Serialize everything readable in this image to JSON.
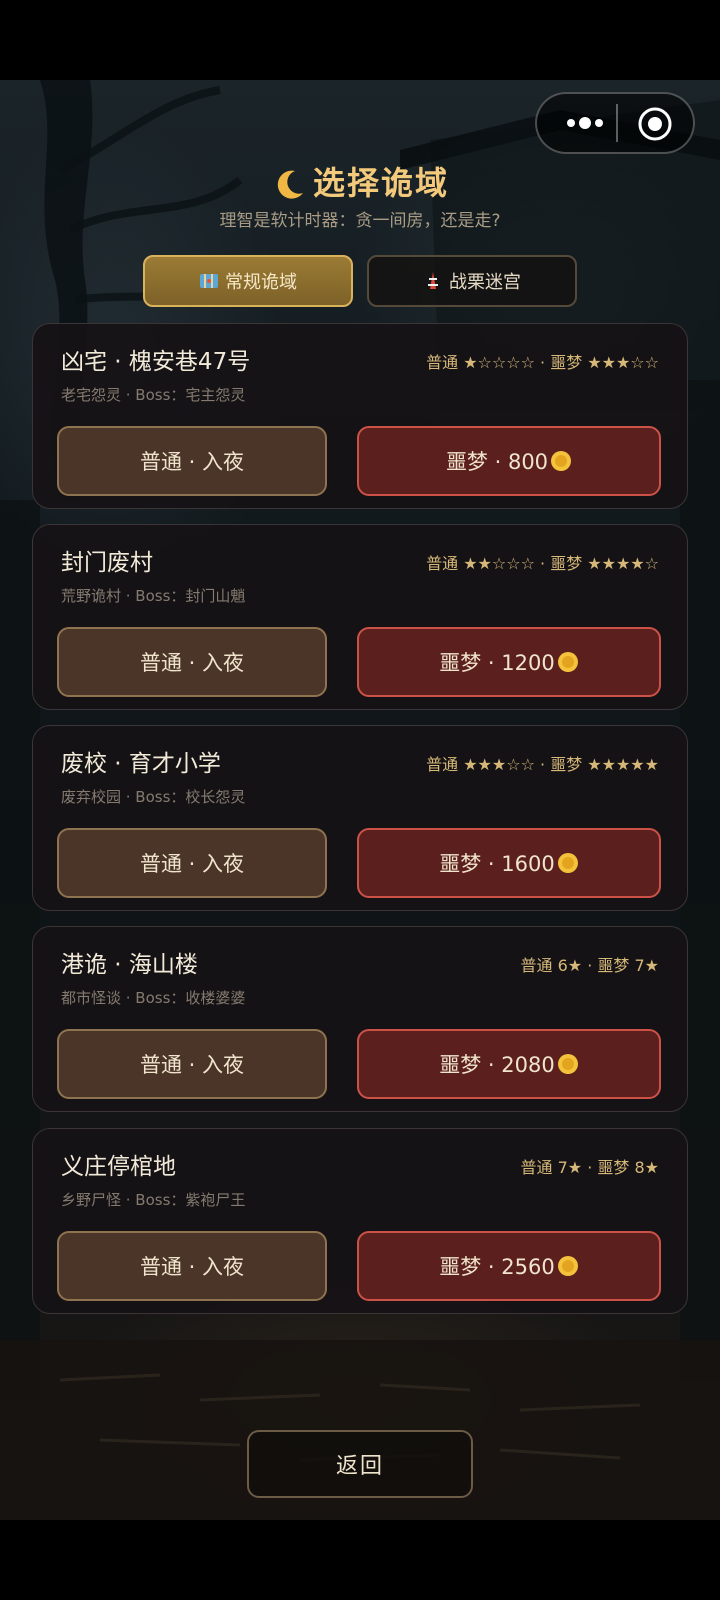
{
  "header": {
    "title": "选择诡域",
    "subtitle": "理智是软计时器：贪一间房，还是走?"
  },
  "tabs": [
    {
      "label": "常规诡域",
      "icon": "map-icon",
      "active": true
    },
    {
      "label": "战栗迷宫",
      "icon": "tower-icon",
      "active": false
    }
  ],
  "domains": [
    {
      "name": "凶宅 · 槐安巷47号",
      "meta": "老宅怨灵 · Boss：宅主怨灵",
      "difficulty": "普通 ★☆☆☆☆ · 噩梦 ★★★☆☆",
      "normal_label": "普通 · 入夜",
      "nightmare_label": "噩梦 · 800"
    },
    {
      "name": "封门废村",
      "meta": "荒野诡村 · Boss：封门山魈",
      "difficulty": "普通 ★★☆☆☆ · 噩梦 ★★★★☆",
      "normal_label": "普通 · 入夜",
      "nightmare_label": "噩梦 · 1200"
    },
    {
      "name": "废校 · 育才小学",
      "meta": "废弃校园 · Boss：校长怨灵",
      "difficulty": "普通 ★★★☆☆ · 噩梦 ★★★★★",
      "normal_label": "普通 · 入夜",
      "nightmare_label": "噩梦 · 1600"
    },
    {
      "name": "港诡 · 海山楼",
      "meta": "都市怪谈 · Boss：收楼婆婆",
      "difficulty": "普通 6★ · 噩梦 7★",
      "normal_label": "普通 · 入夜",
      "nightmare_label": "噩梦 · 2080"
    },
    {
      "name": "义庄停棺地",
      "meta": "乡野尸怪 · Boss：紫袍尸王",
      "difficulty": "普通 7★ · 噩梦 8★",
      "normal_label": "普通 · 入夜",
      "nightmare_label": "噩梦 · 2560"
    }
  ],
  "footer": {
    "back_label": "返回"
  },
  "colors": {
    "accent": "#f3c97b",
    "nightmare_border": "#cc5248",
    "normal_border": "#8e7350"
  }
}
